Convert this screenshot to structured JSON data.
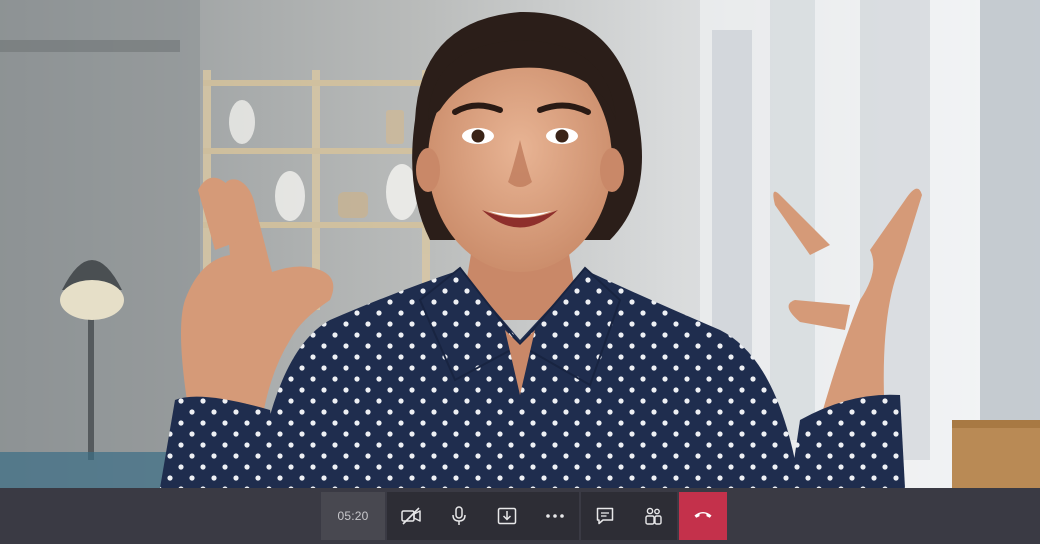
{
  "call": {
    "duration": "05:20"
  },
  "controls": {
    "camera": {
      "icon": "camera-off-icon",
      "state": "off"
    },
    "microphone": {
      "icon": "microphone-icon",
      "state": "on"
    },
    "share": {
      "icon": "share-tray-icon"
    },
    "more": {
      "icon": "more-options-icon"
    },
    "chat": {
      "icon": "chat-icon"
    },
    "participants": {
      "icon": "participants-icon"
    },
    "hangup": {
      "icon": "hang-up-icon"
    }
  },
  "colors": {
    "bar_background": "#3a3a44",
    "hangup": "#c4314b",
    "icon": "#e8e8ea"
  }
}
